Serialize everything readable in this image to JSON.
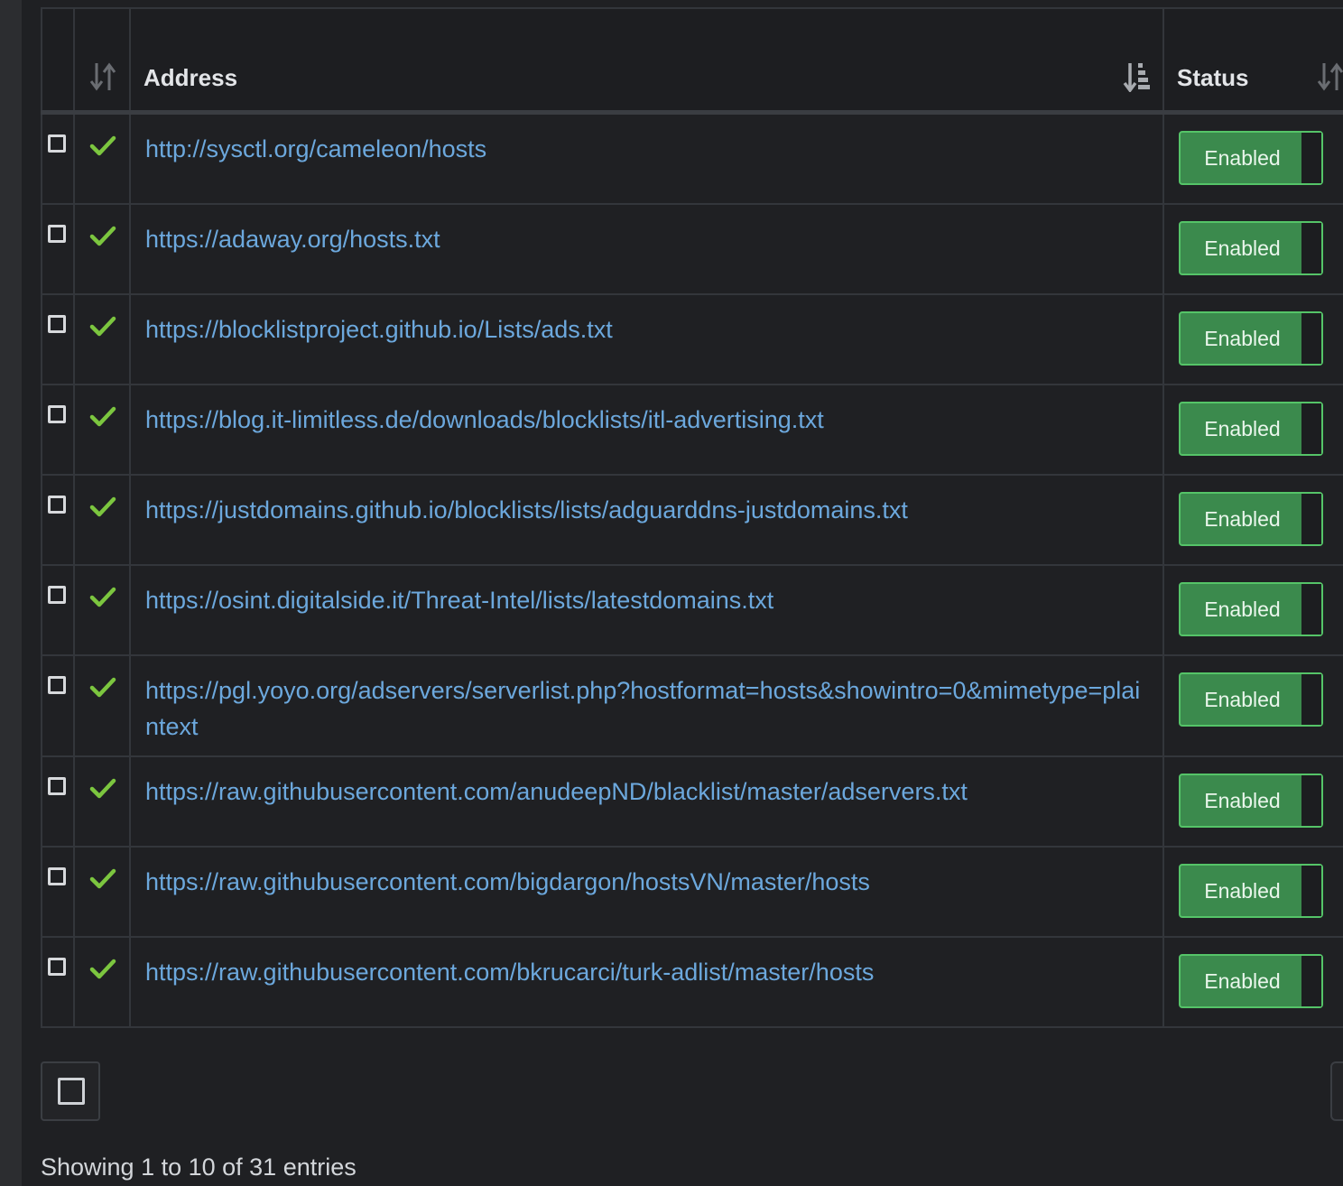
{
  "table": {
    "headers": {
      "address": "Address",
      "status": "Status"
    },
    "rows": [
      {
        "address": "http://sysctl.org/cameleon/hosts",
        "status": "Enabled"
      },
      {
        "address": "https://adaway.org/hosts.txt",
        "status": "Enabled"
      },
      {
        "address": "https://blocklistproject.github.io/Lists/ads.txt",
        "status": "Enabled"
      },
      {
        "address": "https://blog.it-limitless.de/downloads/blocklists/itl-advertising.txt",
        "status": "Enabled"
      },
      {
        "address": "https://justdomains.github.io/blocklists/lists/adguarddns-justdomains.txt",
        "status": "Enabled"
      },
      {
        "address": "https://osint.digitalside.it/Threat-Intel/lists/latestdomains.txt",
        "status": "Enabled"
      },
      {
        "address": "https://pgl.yoyo.org/adservers/serverlist.php?hostformat=hosts&showintro=0&mimetype=plaintext",
        "status": "Enabled"
      },
      {
        "address": "https://raw.githubusercontent.com/anudeepND/blacklist/master/adservers.txt",
        "status": "Enabled"
      },
      {
        "address": "https://raw.githubusercontent.com/bigdargon/hostsVN/master/hosts",
        "status": "Enabled"
      },
      {
        "address": "https://raw.githubusercontent.com/bkrucarci/turk-adlist/master/hosts",
        "status": "Enabled"
      }
    ]
  },
  "footer": {
    "info": "Showing 1 to 10 of 31 entries"
  },
  "icons": {
    "status_ok": "check-icon",
    "sort": "sort-icon",
    "sort_active": "sort-ascending-icon"
  },
  "colors": {
    "link": "#6ca8dd",
    "check": "#7cc63f",
    "toggle_on": "#3b8a4d",
    "toggle_border": "#55c468"
  }
}
